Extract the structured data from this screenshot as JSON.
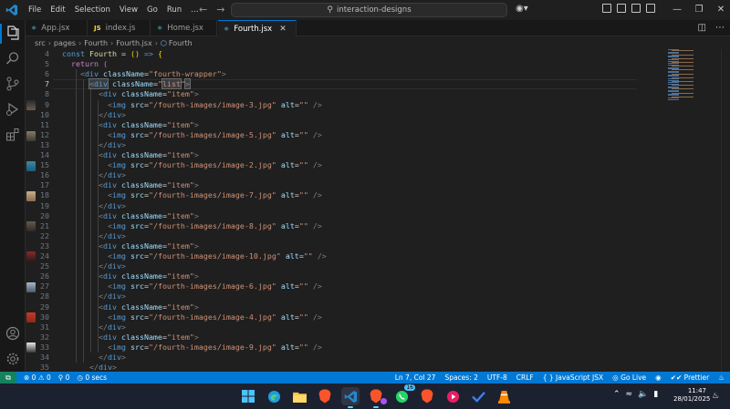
{
  "menu": [
    "File",
    "Edit",
    "Selection",
    "View",
    "Go",
    "Run",
    "…"
  ],
  "command_center": "interaction-designs",
  "tabs": [
    {
      "label": "App.jsx",
      "icon_text": "⚛",
      "icon_color": "#61dafb",
      "active": false
    },
    {
      "label": "index.js",
      "icon_text": "JS",
      "icon_color": "#f1dd35",
      "active": false
    },
    {
      "label": "Home.jsx",
      "icon_text": "⚛",
      "icon_color": "#61dafb",
      "active": false
    },
    {
      "label": "Fourth.jsx",
      "icon_text": "⚛",
      "icon_color": "#61dafb",
      "active": true
    }
  ],
  "breadcrumb": [
    "src",
    "pages",
    "Fourth",
    "Fourth.jsx",
    "Fourth"
  ],
  "code": {
    "line_numbers": [
      "4",
      "5",
      "6",
      "7",
      "8",
      "9",
      "10",
      "11",
      "12",
      "13",
      "14",
      "15",
      "16",
      "17",
      "18",
      "19",
      "20",
      "21",
      "22",
      "23",
      "24",
      "25",
      "26",
      "27",
      "28",
      "29",
      "30",
      "31",
      "32",
      "33",
      "34",
      "35"
    ],
    "current_line": "7",
    "images": [
      "/fourth-images/image-3.jpg",
      "/fourth-images/image-5.jpg",
      "/fourth-images/image-2.jpg",
      "/fourth-images/image-7.jpg",
      "/fourth-images/image-8.jpg",
      "/fourth-images/image-10.jpg",
      "/fourth-images/image-6.jpg",
      "/fourth-images/image-4.jpg",
      "/fourth-images/image-9.jpg"
    ],
    "component_name": "Fourth",
    "wrapper_class": "fourth-wrapper",
    "list_class": "list",
    "item_class": "item"
  },
  "status": {
    "errors": "0",
    "warnings": "0",
    "ports": "0",
    "time": "0 secs",
    "position": "Ln 7, Col 27",
    "spaces": "Spaces: 2",
    "encoding": "UTF-8",
    "eol": "CRLF",
    "language": "JavaScript JSX",
    "golive": "Go Live",
    "prettier": "Prettier"
  },
  "taskbar": {
    "time": "11:47",
    "date": "28/01/2025",
    "whatsapp_badge": "16"
  },
  "colors": {
    "accent": "#0078d4",
    "remote": "#16825d",
    "editor_bg": "#1f1f1f"
  }
}
